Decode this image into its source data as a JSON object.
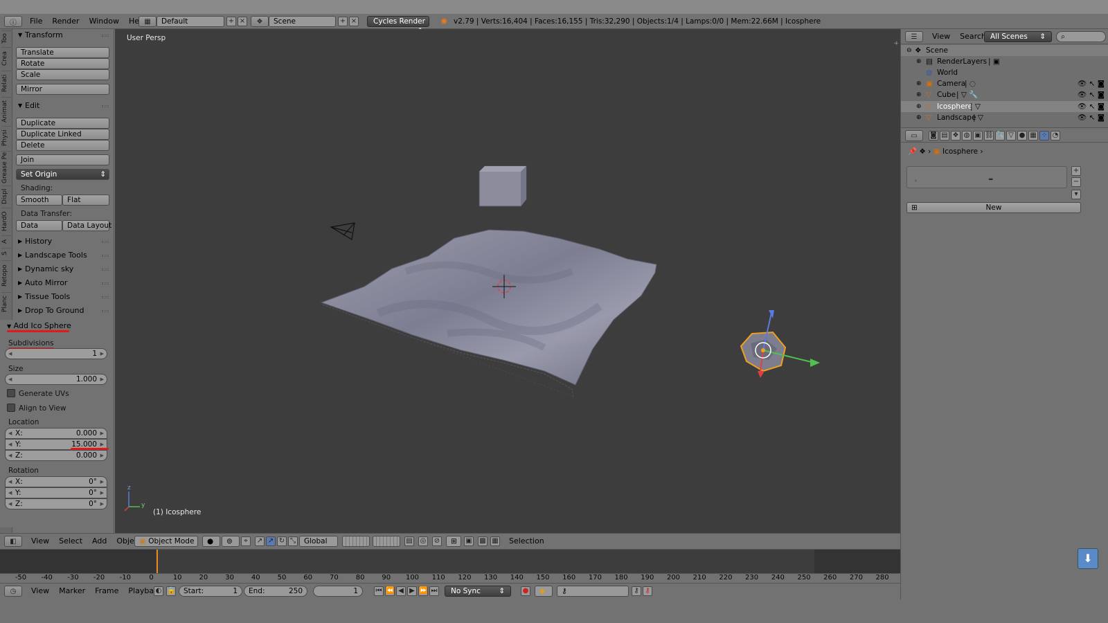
{
  "topbar": {
    "menus": [
      "File",
      "Render",
      "Window",
      "Help"
    ],
    "layout": "Default",
    "scene": "Scene",
    "engine": "Cycles Render",
    "stats": "v2.79 | Verts:16,404 | Faces:16,155 | Tris:32,290 | Objects:1/4 | Lamps:0/0 | Mem:22.66M | Icosphere"
  },
  "shelf_tabs": [
    "Too",
    "Crea",
    "Relati",
    "Animat",
    "Physi",
    "Grease Pe",
    "Displ",
    "HardO",
    "A",
    "S",
    "Retopo",
    "Planc"
  ],
  "tool_panel": {
    "transform_header": "Transform",
    "transform_buttons": [
      "Translate",
      "Rotate",
      "Scale",
      "Mirror"
    ],
    "edit_header": "Edit",
    "edit_buttons": [
      "Duplicate",
      "Duplicate Linked",
      "Delete",
      "Join"
    ],
    "set_origin": "Set Origin",
    "shading_label": "Shading:",
    "smooth": "Smooth",
    "flat": "Flat",
    "data_transfer_label": "Data Transfer:",
    "data": "Data",
    "data_layout": "Data Layout",
    "collapsed_panels": [
      "History",
      "Landscape Tools",
      "Dynamic sky",
      "Auto Mirror",
      "Tissue Tools",
      "Drop To Ground"
    ]
  },
  "operator": {
    "title": "Add Ico Sphere",
    "subdivisions_label": "Subdivisions",
    "subdivisions": "1",
    "size_label": "Size",
    "size": "1.000",
    "generate_uvs": "Generate UVs",
    "align_to_view": "Align to View",
    "location_label": "Location",
    "loc_x_label": "X:",
    "loc_x": "0.000",
    "loc_y_label": "Y:",
    "loc_y": "15.000",
    "loc_z_label": "Z:",
    "loc_z": "0.000",
    "rotation_label": "Rotation",
    "rot_x_label": "X:",
    "rot_x": "0°",
    "rot_y_label": "Y:",
    "rot_y": "0°",
    "rot_z_label": "Z:",
    "rot_z": "0°"
  },
  "viewport": {
    "view_name": "User Persp",
    "active_object": "(1) Icosphere",
    "axis_z": "z",
    "axis_y": "y"
  },
  "view_header": {
    "menus": [
      "View",
      "Select",
      "Add",
      "Object"
    ],
    "mode": "Object Mode",
    "orientation": "Global",
    "selection_label": "Selection"
  },
  "timeline": {
    "ticks": [
      "-50",
      "-40",
      "-30",
      "-20",
      "-10",
      "0",
      "10",
      "20",
      "30",
      "40",
      "50",
      "60",
      "70",
      "80",
      "90",
      "100",
      "110",
      "120",
      "130",
      "140",
      "150",
      "160",
      "170",
      "180",
      "190",
      "200",
      "210",
      "220",
      "230",
      "240",
      "250",
      "260",
      "270",
      "280"
    ],
    "menus": [
      "View",
      "Marker",
      "Frame",
      "Playback"
    ],
    "start_label": "Start:",
    "start": "1",
    "end_label": "End:",
    "end": "250",
    "current": "1",
    "sync": "No Sync"
  },
  "outliner": {
    "view": "View",
    "search": "Search",
    "filter": "All Scenes",
    "scene": "Scene",
    "items": [
      "RenderLayers",
      "World",
      "Camera",
      "Cube",
      "Icosphere",
      "Landscape"
    ]
  },
  "properties": {
    "context": "Icosphere",
    "new_button": "New"
  },
  "colors": {
    "accent_red": "#e01919",
    "selection_orange": "#f0a020",
    "viewport_bg": "#3d3d3d"
  }
}
